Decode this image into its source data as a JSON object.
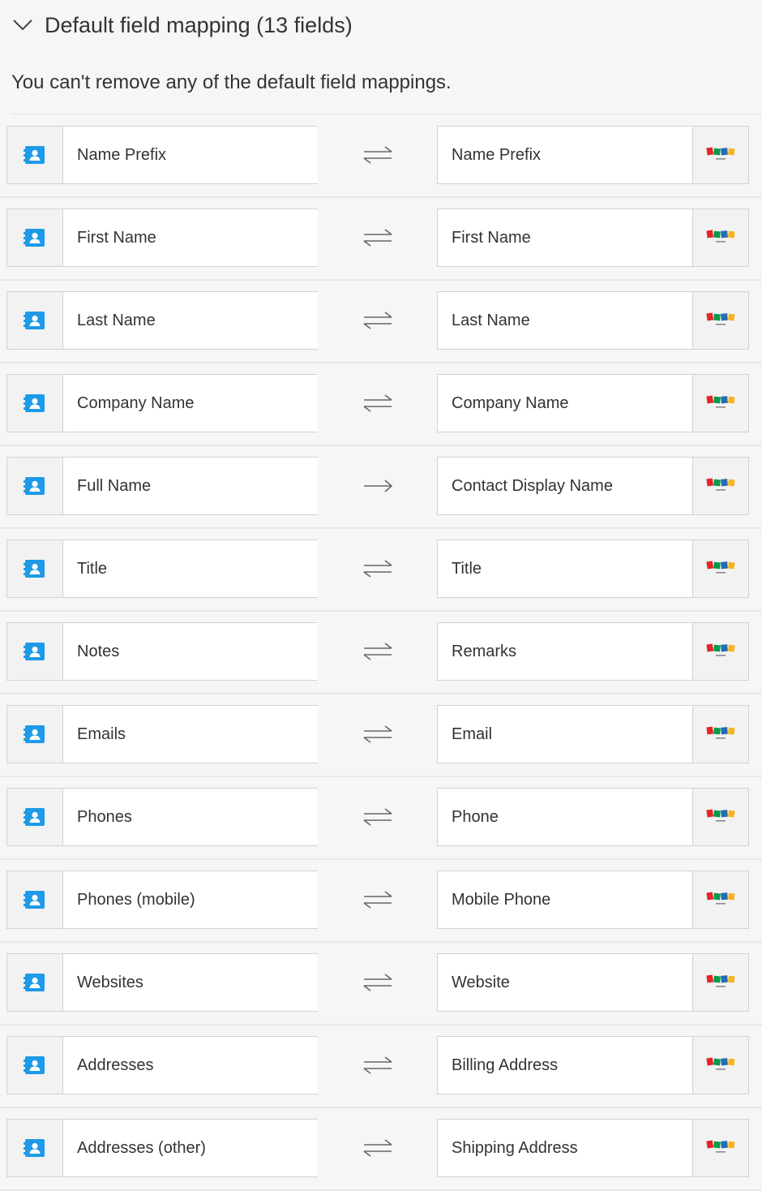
{
  "section": {
    "title": "Default field mapping (13 fields)",
    "note": "You can't remove any of the default field mappings."
  },
  "icons": {
    "toggle": "chevron-down-icon",
    "left_app": "contacts-app-icon",
    "right_app": "zoho-books-logo",
    "two_way": "two-way-sync-arrows-icon",
    "one_way": "one-way-arrow-icon"
  },
  "colors": {
    "contacts_blue": "#1d9ae8",
    "zoho_red": "#e42527",
    "zoho_green": "#089949",
    "zoho_blue": "#226db4",
    "zoho_yellow": "#f9b21d"
  },
  "mappings": [
    {
      "left": "Name Prefix",
      "right": "Name Prefix",
      "direction": "two-way"
    },
    {
      "left": "First Name",
      "right": "First Name",
      "direction": "two-way"
    },
    {
      "left": "Last Name",
      "right": "Last Name",
      "direction": "two-way"
    },
    {
      "left": "Company Name",
      "right": "Company Name",
      "direction": "two-way"
    },
    {
      "left": "Full Name",
      "right": "Contact Display Name",
      "direction": "one-way"
    },
    {
      "left": "Title",
      "right": "Title",
      "direction": "two-way"
    },
    {
      "left": "Notes",
      "right": "Remarks",
      "direction": "two-way"
    },
    {
      "left": "Emails",
      "right": "Email",
      "direction": "two-way"
    },
    {
      "left": "Phones",
      "right": "Phone",
      "direction": "two-way"
    },
    {
      "left": "Phones (mobile)",
      "right": "Mobile Phone",
      "direction": "two-way"
    },
    {
      "left": "Websites",
      "right": "Website",
      "direction": "two-way"
    },
    {
      "left": "Addresses",
      "right": "Billing Address",
      "direction": "two-way"
    },
    {
      "left": "Addresses (other)",
      "right": "Shipping Address",
      "direction": "two-way"
    }
  ]
}
